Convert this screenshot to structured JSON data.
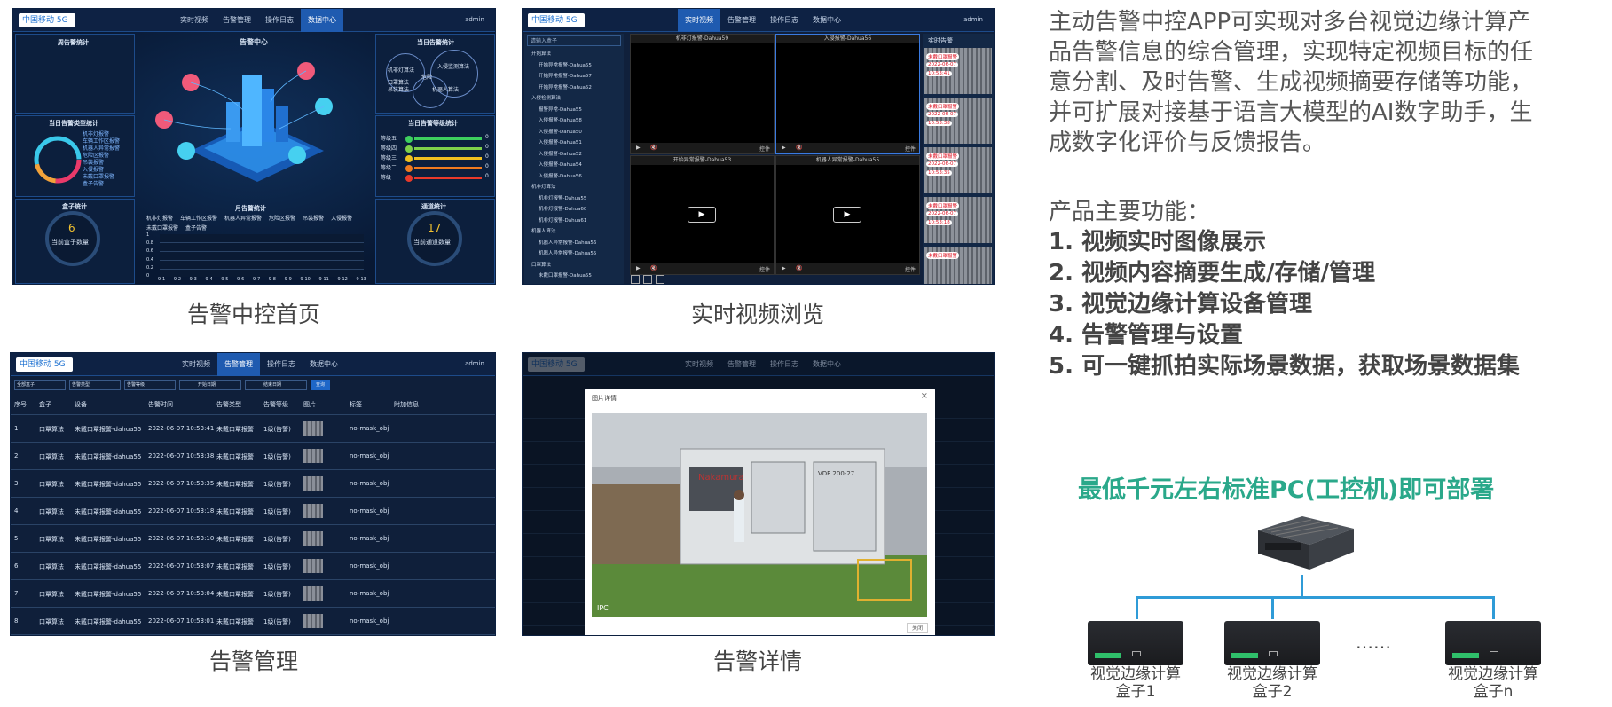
{
  "captions": {
    "home": "告警中控首页",
    "live_video": "实时视频浏览",
    "alarm_mgmt": "告警管理",
    "alarm_detail": "告警详情"
  },
  "nav": {
    "logo": "中国移动 5G",
    "items": [
      "实时视频",
      "告警管理",
      "操作日志",
      "数据中心"
    ],
    "user": "admin"
  },
  "dashboard": {
    "left_top_title": "周告警统计",
    "center_title": "告警中心",
    "right_top_title": "当日告警统计",
    "left_mid_title": "当日告警类型统计",
    "right_mid_title": "当日告警等级统计",
    "box_stats_title": "盒子统计",
    "box_count": "6",
    "box_count_label": "当前盒子数量",
    "channel_stats_title": "通道统计",
    "channel_count": "17",
    "channel_count_label": "当前通道数量",
    "monthly_title": "月告警统计",
    "week_labels": [
      "机非灯算法",
      "入侵监测算法",
      "口罩算法",
      "吊装算法",
      "机器人算法",
      "危险"
    ],
    "week_values": [
      "0",
      "0",
      "0",
      "0",
      "0",
      "0"
    ],
    "type_legend": [
      "机非灯报警",
      "车辆工作区报警",
      "机器人异常报警",
      "危险区报警",
      "吊装报警",
      "入侵报警",
      "未戴口罩报警",
      "盒子告警"
    ],
    "level_labels": [
      "等级五",
      "等级四",
      "等级三",
      "等级二",
      "等级一"
    ],
    "level_values": [
      "0",
      "0",
      "0",
      "0",
      "0"
    ],
    "level_colors": [
      "#3ecf5e",
      "#7fd14a",
      "#f0c020",
      "#f07a20",
      "#e83a2a"
    ],
    "monthly_legend": [
      "机非灯报警",
      "车辆工作区报警",
      "机器人异常报警",
      "危险区报警",
      "吊装报警",
      "入侵报警",
      "未戴口罩报警",
      "盒子告警"
    ],
    "monthly_y": [
      "1",
      "0.8",
      "0.6",
      "0.4",
      "0.2",
      "0"
    ],
    "monthly_x": [
      "9-1",
      "9-2",
      "9-3",
      "9-4",
      "9-5",
      "9-6",
      "9-7",
      "9-8",
      "9-9",
      "9-10",
      "9-11",
      "9-12",
      "9-13"
    ]
  },
  "live": {
    "search_placeholder": "请输入盒子",
    "tree": [
      "开始算法",
      "开始异常报警-Dahua55",
      "开始异常报警-Dahua57",
      "开始异常报警-Dahua52",
      "入侵检测算法",
      "报警异常-Dahua55",
      "入侵报警-Dahua58",
      "入侵报警-Dahua50",
      "入侵报警-Dahua51",
      "入侵报警-Dahua52",
      "入侵报警-Dahua54",
      "入侵报警-Dahua56",
      "机非灯算法",
      "机非灯报警-Dahua55",
      "机非灯报警-Dahua60",
      "机非灯报警-Dahua61",
      "机器人算法",
      "机器人异常报警-Dahua56",
      "机器人异常报警-Dahua55",
      "口罩算法",
      "未戴口罩报警-Dahua55"
    ],
    "videos": [
      "机非灯报警-Dahua59",
      "入侵报警-Dahua56",
      "开始异常报警-Dahua53",
      "机器人异常报警-Dahua55"
    ],
    "realtime_title": "实时告警",
    "alerts": [
      {
        "label": "未戴口罩报警",
        "date": "2022-06-07",
        "time": "10:53:41"
      },
      {
        "label": "未戴口罩报警",
        "date": "2022-06-07",
        "time": "10:53:38"
      },
      {
        "label": "未戴口罩报警",
        "date": "2022-06-07",
        "time": "10:53:35"
      },
      {
        "label": "未戴口罩报警",
        "date": "2022-06-07",
        "time": "10:53:18"
      },
      {
        "label": "未戴口罩报警",
        "date": "",
        "time": ""
      }
    ],
    "ctrl_label": "控件"
  },
  "alarm_table": {
    "filters": [
      "全部盒子",
      "告警类型",
      "告警等级",
      "开始日期",
      "结束日期"
    ],
    "search_btn": "查询",
    "headers": [
      "序号",
      "盒子",
      "设备",
      "告警时间",
      "告警类型",
      "告警等级",
      "图片",
      "标签",
      "附加信息"
    ],
    "rows": [
      [
        "1",
        "口罩算法",
        "未戴口罩报警-dahua55",
        "2022-06-07 10:53:41",
        "未戴口罩报警",
        "1级(告警)",
        "no-mask_obj"
      ],
      [
        "2",
        "口罩算法",
        "未戴口罩报警-dahua55",
        "2022-06-07 10:53:38",
        "未戴口罩报警",
        "1级(告警)",
        "no-mask_obj"
      ],
      [
        "3",
        "口罩算法",
        "未戴口罩报警-dahua55",
        "2022-06-07 10:53:35",
        "未戴口罩报警",
        "1级(告警)",
        "no-mask_obj"
      ],
      [
        "4",
        "口罩算法",
        "未戴口罩报警-dahua55",
        "2022-06-07 10:53:18",
        "未戴口罩报警",
        "1级(告警)",
        "no-mask_obj"
      ],
      [
        "5",
        "口罩算法",
        "未戴口罩报警-dahua55",
        "2022-06-07 10:53:10",
        "未戴口罩报警",
        "1级(告警)",
        "no-mask_obj"
      ],
      [
        "6",
        "口罩算法",
        "未戴口罩报警-dahua55",
        "2022-06-07 10:53:07",
        "未戴口罩报警",
        "1级(告警)",
        "no-mask_obj"
      ],
      [
        "7",
        "口罩算法",
        "未戴口罩报警-dahua55",
        "2022-06-07 10:53:04",
        "未戴口罩报警",
        "1级(告警)",
        "no-mask_obj"
      ],
      [
        "8",
        "口罩算法",
        "未戴口罩报警-dahua55",
        "2022-06-07 10:53:01",
        "未戴口罩报警",
        "1级(告警)",
        "no-mask_obj"
      ]
    ]
  },
  "detail": {
    "modal_title": "图片详情",
    "close_x": "×",
    "close_btn": "关闭",
    "machine_brand": "Nakamura",
    "machine_model": "VDF 200-27",
    "corner_text": "IPC"
  },
  "product": {
    "intro": [
      "主动告警中控APP可实现对多台视觉边缘计算产",
      "品告警信息的综合管理，实现特定视频目标的任",
      "意分割、及时告警、生成视频摘要存储等功能，",
      "并可扩展对接基于语言大模型的AI数字助手，生",
      "成数字化评价与反馈报告。"
    ],
    "features_title": "产品主要功能：",
    "features": [
      "1. 视频实时图像展示",
      "2. 视频内容摘要生成/存储/管理",
      "3. 视觉边缘计算设备管理",
      "4. 告警管理与设置",
      "5. 可一键抓拍实际场景数据，获取场景数据集"
    ],
    "deploy_title": "最低千元左右标准PC(工控机)即可部署",
    "deploy_color": "#2aa88a",
    "boxes": [
      [
        "视觉边缘计算",
        "盒子1"
      ],
      [
        "视觉边缘计算",
        "盒子2"
      ],
      [
        "视觉边缘计算",
        "盒子n"
      ]
    ],
    "ellipsis": "……"
  }
}
